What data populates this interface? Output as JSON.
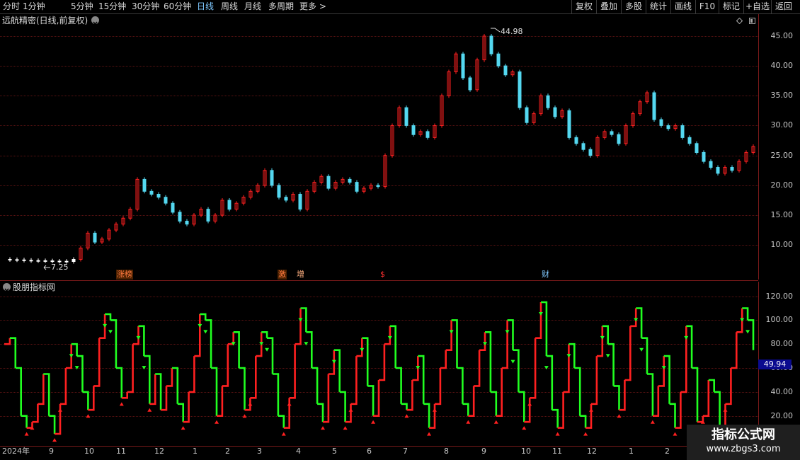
{
  "toolbar": {
    "periods": [
      "分时",
      "1分钟",
      "5分钟",
      "15分钟",
      "30分钟",
      "60分钟",
      "日线",
      "周线",
      "月线",
      "多周期",
      "更多 >"
    ],
    "active_period": "日线",
    "buttons": [
      "复权",
      "叠加",
      "多股",
      "统计",
      "画线",
      "F10",
      "标记",
      "+自选",
      "返回"
    ]
  },
  "main_chart": {
    "title": "远航精密(日线,前复权)",
    "high_label": "44.98",
    "low_label": "7.25",
    "markers": [
      {
        "text": "涨榜",
        "color": "#ff5030"
      },
      {
        "text": "激",
        "color": "#ff5030"
      },
      {
        "text": "增",
        "color": "#ff5030"
      },
      {
        "text": "$",
        "color": "#ff3030"
      },
      {
        "text": "财",
        "color": "#7ec8ff"
      }
    ]
  },
  "sub_chart": {
    "title": "股朋指标网",
    "current_value": "49.94"
  },
  "x_axis_labels": [
    "2024年",
    "9",
    "10",
    "11",
    "12",
    "1",
    "2",
    "3",
    "4",
    "5",
    "6",
    "7",
    "8",
    "9",
    "10",
    "11",
    "12",
    "1",
    "2"
  ],
  "watermark": {
    "title": "指标公式网",
    "url": "www.zbgs3.com"
  },
  "colors": {
    "up": "#ff2020",
    "down": "#20ff20",
    "flat_line": "#ffffff",
    "accent": "#7ec8ff",
    "grid": "#5a1212"
  },
  "chart_data": [
    {
      "type": "line",
      "title": "远航精密(日线,前复权)",
      "ylim": [
        6,
        47
      ],
      "y_ticks": [
        10,
        15,
        20,
        25,
        30,
        35,
        40,
        45
      ],
      "y_tick_labels": [
        "10.00",
        "15.00",
        "20.00",
        "25.00",
        "30.00",
        "35.00",
        "40.00",
        "45.00"
      ],
      "series": [
        {
          "name": "",
          "values": [
            7.6,
            7.55,
            7.5,
            7.45,
            7.4,
            7.38,
            7.35,
            7.3,
            7.28,
            7.25,
            7.6,
            9.5,
            12.0,
            10.5,
            11.0,
            12.5,
            13.5,
            14.5,
            16.0,
            21.0,
            19.0,
            18.5,
            18.0,
            17.0,
            15.5,
            14.0,
            13.5,
            15.0,
            16.0,
            14.0,
            15.0,
            17.5,
            16.0,
            17.0,
            18.0,
            19.0,
            20.0,
            22.5,
            20.0,
            18.0,
            17.5,
            18.5,
            16.0,
            19.0,
            20.5,
            21.5,
            19.5,
            20.5,
            21.0,
            20.5,
            19.0,
            19.5,
            20.0,
            19.8,
            25.0,
            30.0,
            33.0,
            30.0,
            28.5,
            29.0,
            28.0,
            30.0,
            35.0,
            39.0,
            42.0,
            38.0,
            36.0,
            41.0,
            44.98,
            42.0,
            40.0,
            38.5,
            39.0,
            33.0,
            30.5,
            32.0,
            35.0,
            33.0,
            31.5,
            32.5,
            28.0,
            27.0,
            26.0,
            25.0,
            28.0,
            29.0,
            28.5,
            27.0,
            30.0,
            32.0,
            34.0,
            35.5,
            31.0,
            30.0,
            29.5,
            30.0,
            28.0,
            27.0,
            25.5,
            24.0,
            23.0,
            22.0,
            23.0,
            22.5,
            24.0,
            25.5,
            26.5
          ]
        }
      ]
    },
    {
      "type": "line",
      "title": "股朋指标网",
      "ylim": [
        -5,
        128
      ],
      "y_ticks": [
        20,
        40,
        60,
        80,
        100,
        120
      ],
      "y_tick_labels": [
        "20.00",
        "40.00",
        "60.00",
        "80.00",
        "100.00",
        "120.00"
      ],
      "series": [
        {
          "name": "",
          "values": [
            80,
            85,
            60,
            20,
            10,
            15,
            30,
            55,
            20,
            5,
            30,
            60,
            80,
            70,
            40,
            25,
            45,
            85,
            105,
            100,
            60,
            35,
            40,
            80,
            95,
            70,
            30,
            55,
            25,
            45,
            60,
            30,
            15,
            40,
            70,
            105,
            100,
            60,
            20,
            45,
            80,
            90,
            60,
            25,
            35,
            70,
            90,
            85,
            55,
            20,
            10,
            35,
            80,
            110,
            90,
            60,
            30,
            15,
            55,
            75,
            40,
            15,
            30,
            70,
            85,
            45,
            20,
            50,
            80,
            95,
            60,
            30,
            25,
            50,
            70,
            30,
            10,
            30,
            60,
            75,
            100,
            60,
            30,
            20,
            45,
            75,
            90,
            40,
            20,
            60,
            100,
            75,
            40,
            15,
            35,
            85,
            115,
            70,
            25,
            10,
            40,
            80,
            60,
            20,
            10,
            30,
            70,
            95,
            80,
            45,
            25,
            50,
            95,
            110,
            85,
            55,
            20,
            45,
            70,
            30,
            10,
            40,
            95,
            60,
            15,
            20,
            50,
            40,
            10,
            30,
            60,
            90,
            110,
            100,
            75
          ]
        }
      ]
    }
  ]
}
